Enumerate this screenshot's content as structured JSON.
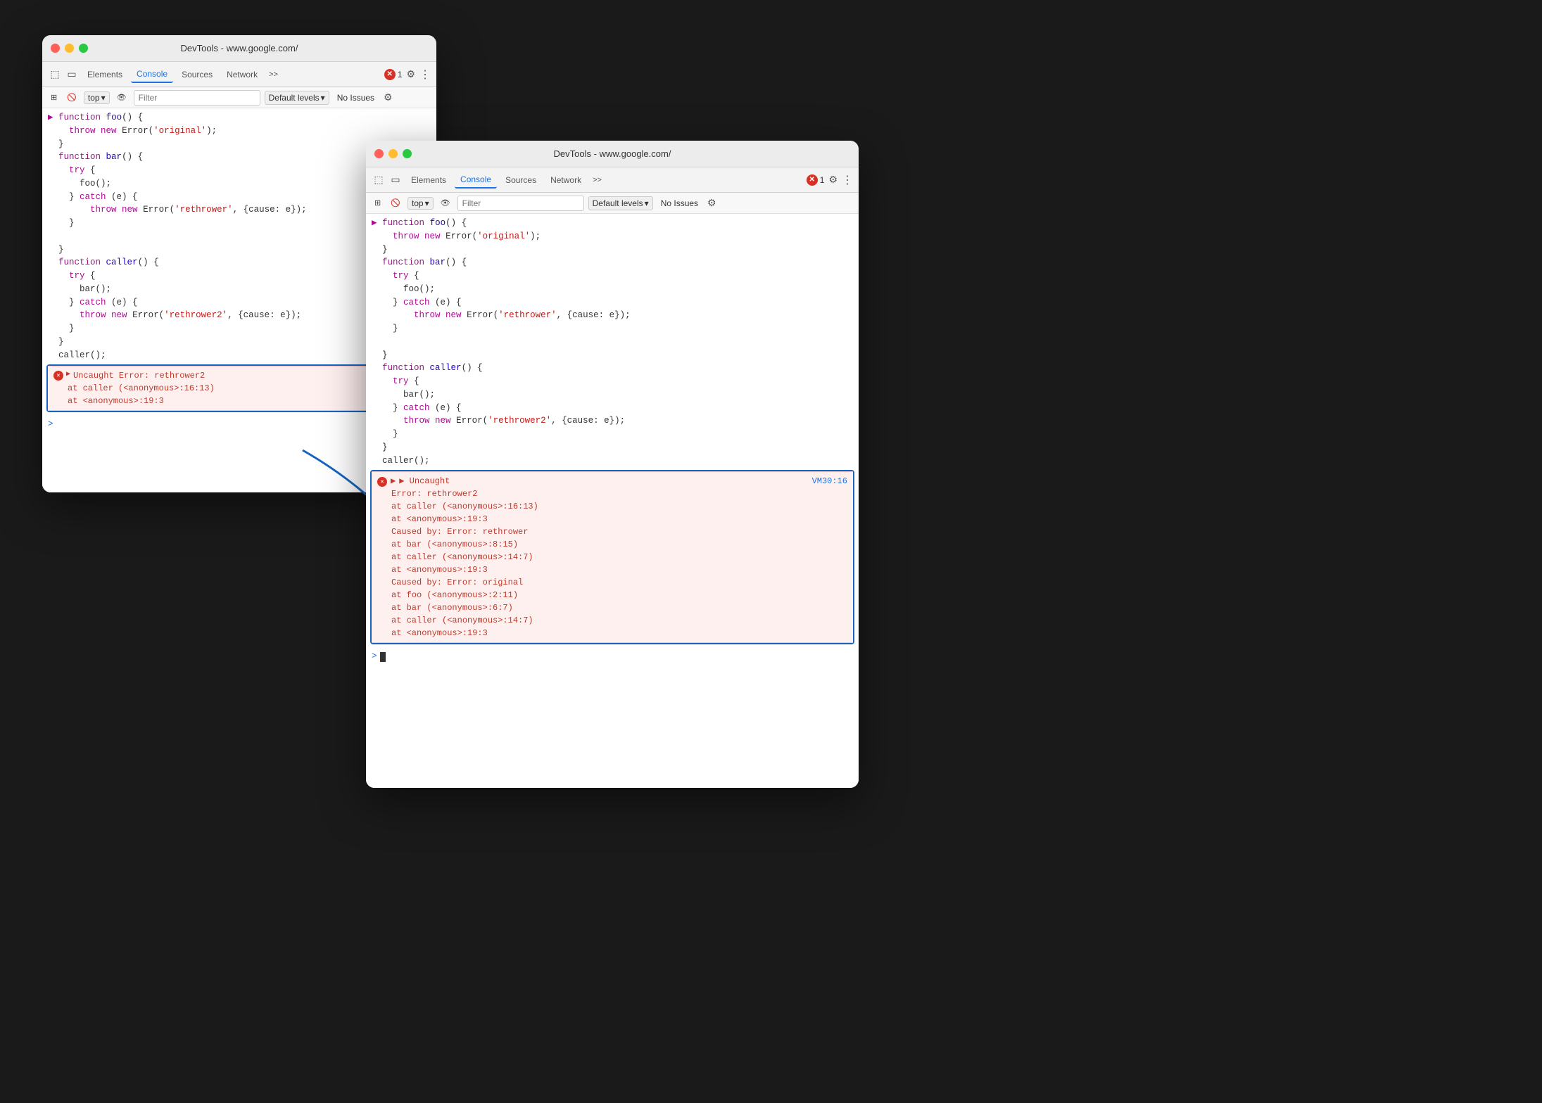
{
  "app": {
    "title": "DevTools - www.google.com/"
  },
  "window_back": {
    "title": "DevTools - www.google.com/",
    "tabs": [
      "Elements",
      "Console",
      "Sources",
      "Network",
      ">>"
    ],
    "active_tab": "Console",
    "console_toolbar": {
      "context": "top",
      "filter_placeholder": "Filter",
      "level": "Default levels",
      "issues": "No Issues"
    },
    "code": [
      {
        "indent": 0,
        "content": "▶ function foo() {"
      },
      {
        "indent": 2,
        "content": "    throw new Error('original');"
      },
      {
        "indent": 0,
        "content": "  }"
      },
      {
        "indent": 0,
        "content": "  function bar() {"
      },
      {
        "indent": 2,
        "content": "    try {"
      },
      {
        "indent": 4,
        "content": "      foo();"
      },
      {
        "indent": 2,
        "content": "    } catch (e) {"
      },
      {
        "indent": 4,
        "content": "        throw new Error('rethrower', {cause: e});"
      },
      {
        "indent": 2,
        "content": "    }"
      },
      {
        "indent": 0,
        "content": ""
      },
      {
        "indent": 0,
        "content": "  }"
      },
      {
        "indent": 0,
        "content": "  function caller() {"
      },
      {
        "indent": 2,
        "content": "    try {"
      },
      {
        "indent": 4,
        "content": "      bar();"
      },
      {
        "indent": 2,
        "content": "    } catch (e) {"
      },
      {
        "indent": 4,
        "content": "      throw new Error('rethrower2', {cause: e});"
      },
      {
        "indent": 2,
        "content": "    }"
      },
      {
        "indent": 0,
        "content": "  }"
      },
      {
        "indent": 0,
        "content": "  caller();"
      }
    ],
    "error": {
      "message": "Uncaught Error: rethrower2",
      "trace1": "    at caller (<anonymous>:16:13)",
      "trace2": "    at <anonymous>:19:3"
    },
    "prompt": ">"
  },
  "window_front": {
    "title": "DevTools - www.google.com/",
    "tabs": [
      "Elements",
      "Console",
      "Sources",
      "Network",
      ">>"
    ],
    "active_tab": "Console",
    "console_toolbar": {
      "context": "top",
      "filter_placeholder": "Filter",
      "level": "Default levels",
      "issues": "No Issues"
    },
    "code": [
      "▶ function foo() {",
      "    throw new Error('original');",
      "  }",
      "  function bar() {",
      "    try {",
      "      foo();",
      "    } catch (e) {",
      "        throw new Error('rethrower', {cause: e});",
      "    }",
      "",
      "  }",
      "  function caller() {",
      "    try {",
      "      bar();",
      "    } catch (e) {",
      "      throw new Error('rethrower2', {cause: e});",
      "    }",
      "  }",
      "  caller();"
    ],
    "expanded_error": {
      "header": "▶ Uncaught",
      "vm_link": "VM30:16",
      "line1": "Error: rethrower2",
      "line2": "    at caller (<anonymous>:16:13)",
      "line3": "    at <anonymous>:19:3",
      "line4": "Caused by: Error: rethrower",
      "line5": "    at bar (<anonymous>:8:15)",
      "line6": "    at caller (<anonymous>:14:7)",
      "line7": "    at <anonymous>:19:3",
      "line8": "Caused by: Error: original",
      "line9": "    at foo (<anonymous>:2:11)",
      "line10": "    at bar (<anonymous>:6:7)",
      "line11": "    at caller (<anonymous>:14:7)",
      "line12": "    at <anonymous>:19:3"
    },
    "prompt": ">"
  }
}
